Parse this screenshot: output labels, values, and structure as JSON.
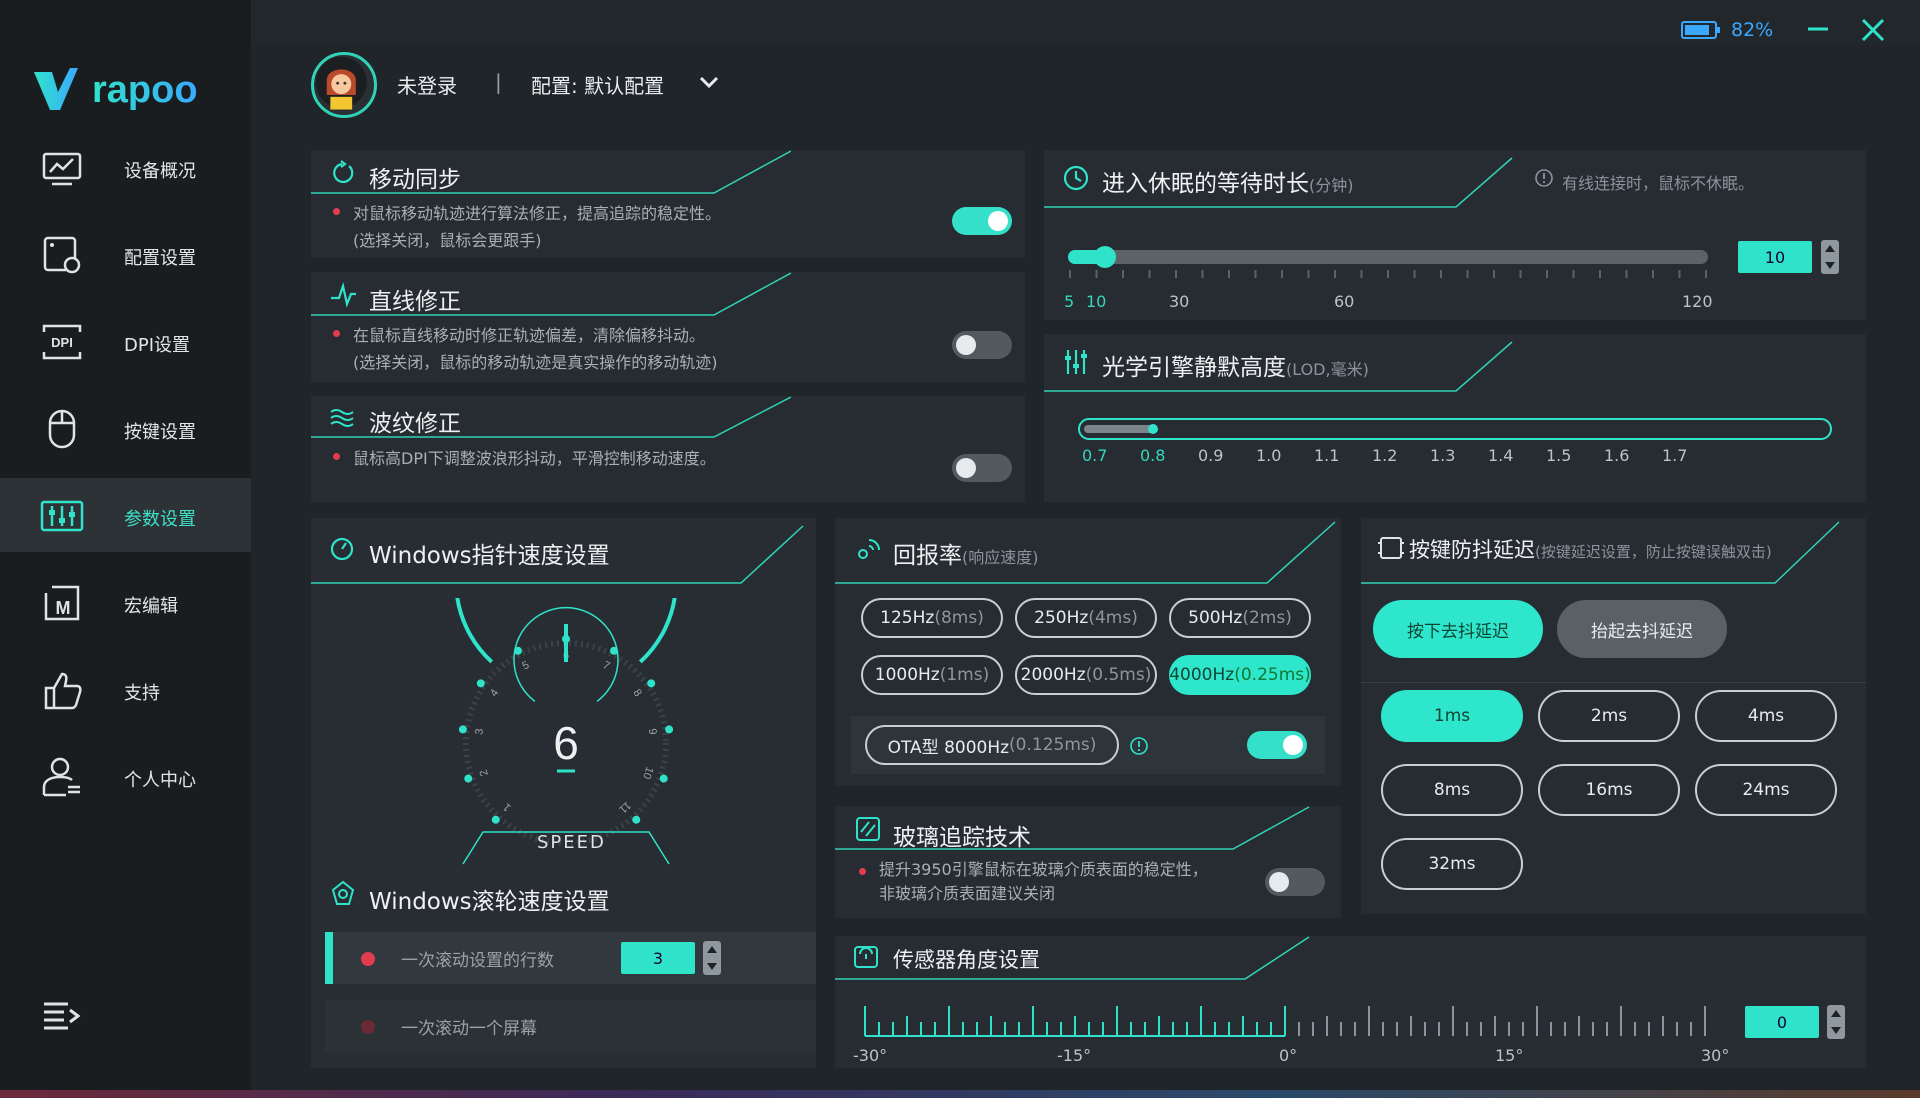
{
  "brand": {
    "name": "rapoo"
  },
  "window": {
    "battery": "82%",
    "accent": "#2fe3ca"
  },
  "sidebar": {
    "items": [
      {
        "label": "设备概况",
        "icon": "device-overview-icon"
      },
      {
        "label": "配置设置",
        "icon": "config-icon"
      },
      {
        "label": "DPI设置",
        "icon": "dpi-icon"
      },
      {
        "label": "按键设置",
        "icon": "mouse-icon"
      },
      {
        "label": "参数设置",
        "icon": "params-icon"
      },
      {
        "label": "宏编辑",
        "icon": "macro-icon"
      },
      {
        "label": "支持",
        "icon": "thumbs-up-icon"
      },
      {
        "label": "个人中心",
        "icon": "user-icon"
      }
    ],
    "active_index": 4
  },
  "header": {
    "user": "未登录",
    "separator": "|",
    "config_label": "配置: 默认配置"
  },
  "motion_sync": {
    "title": "移动同步",
    "desc1": "对鼠标移动轨迹进行算法修正，提高追踪的稳定性。",
    "desc2": "(选择关闭，鼠标会更跟手)",
    "enabled": true
  },
  "angle_snap": {
    "title": "直线修正",
    "desc1": "在鼠标直线移动时修正轨迹偏差，清除偏移抖动。",
    "desc2": "(选择关闭，鼠标的移动轨迹是真实操作的移动轨迹)",
    "enabled": false
  },
  "ripple": {
    "title": "波纹修正",
    "desc1": "鼠标高DPI下调整波浪形抖动，平滑控制移动速度。",
    "enabled": false
  },
  "sleep": {
    "title": "进入休眠的等待时长",
    "unit": "(分钟)",
    "note": "有线连接时，鼠标不休眠。",
    "value": "10",
    "ticks": [
      "5",
      "10",
      "30",
      "60",
      "120"
    ],
    "fraction": 0.04
  },
  "lod": {
    "title": "光学引擎静默高度",
    "unit": "(LOD,毫米)",
    "ticks": [
      "0.7",
      "0.8",
      "0.9",
      "1.0",
      "1.1",
      "1.2",
      "1.3",
      "1.4",
      "1.5",
      "1.6",
      "1.7"
    ],
    "value": "0.8"
  },
  "pointer": {
    "title": "Windows指针速度设置",
    "value": "6",
    "label": "SPEED",
    "dial": [
      "1",
      "2",
      "3",
      "4",
      "5",
      "6",
      "7",
      "8",
      "9",
      "10",
      "11"
    ]
  },
  "scroll": {
    "title": "Windows滚轮速度设置",
    "opt1": "一次滚动设置的行数",
    "opt1_value": "3",
    "opt2": "一次滚动一个屏幕"
  },
  "polling": {
    "title": "回报率",
    "unit": "(响应速度)",
    "rates": [
      {
        "hz": "125Hz",
        "ms": "(8ms)"
      },
      {
        "hz": "250Hz",
        "ms": "(4ms)"
      },
      {
        "hz": "500Hz",
        "ms": "(2ms)"
      },
      {
        "hz": "1000Hz",
        "ms": "(1ms)"
      },
      {
        "hz": "2000Hz",
        "ms": "(0.5ms)"
      },
      {
        "hz": "4000Hz",
        "ms": "(0.25ms)"
      }
    ],
    "selected": "4000Hz",
    "ota_hz": "OTA型 8000Hz",
    "ota_ms": "(0.125ms)",
    "ota_enabled": true
  },
  "glass": {
    "title": "玻璃追踪技术",
    "desc1": "提升3950引擎鼠标在玻璃介质表面的稳定性，",
    "desc2": "非玻璃介质表面建议关闭",
    "enabled": false
  },
  "debounce": {
    "title": "按键防抖延迟",
    "unit": "(按键延迟设置，防止按键误触双击)",
    "tab_press": "按下去抖延迟",
    "tab_release": "抬起去抖延迟",
    "options": [
      "1ms",
      "2ms",
      "4ms",
      "8ms",
      "16ms",
      "24ms",
      "32ms"
    ],
    "selected": "1ms"
  },
  "sensor_angle": {
    "title": "传感器角度设置",
    "value": "0",
    "ticks": [
      "-30°",
      "-15°",
      "0°",
      "15°",
      "30°"
    ]
  }
}
